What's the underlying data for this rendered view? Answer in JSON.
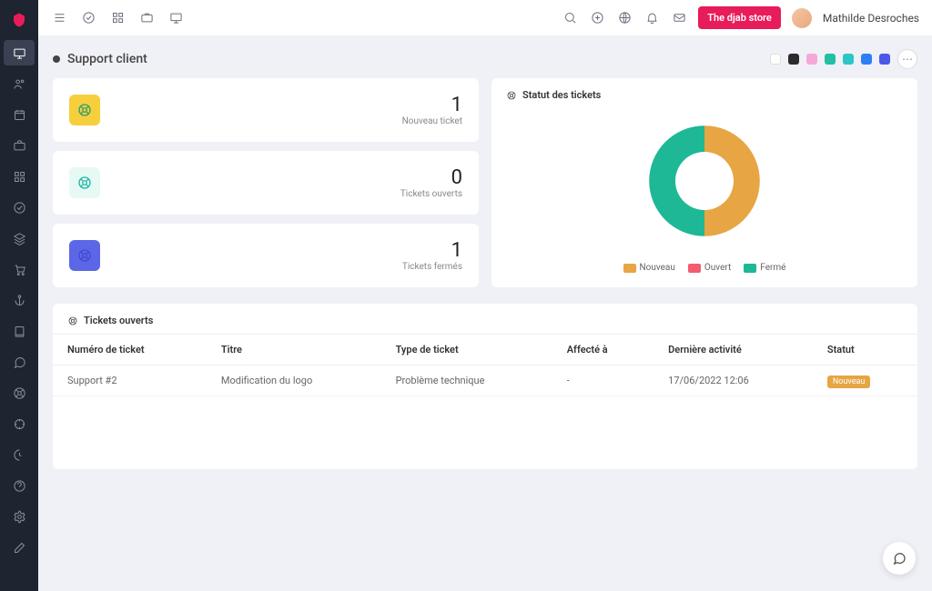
{
  "header": {
    "store_button": "The djab store",
    "username": "Mathilde Desroches"
  },
  "page": {
    "title": "Support client"
  },
  "palette": {
    "colors": [
      "#ffffff",
      "#2b2b2b",
      "#f4a8d8",
      "#22bfa3",
      "#2cc6c6",
      "#2f7ef7",
      "#4a59e8"
    ]
  },
  "stats": {
    "new": {
      "value": "1",
      "label": "Nouveau ticket",
      "bg": "#f7cf3d",
      "ring": "#2f9e6e"
    },
    "open": {
      "value": "0",
      "label": "Tickets ouverts",
      "bg": "#e6f9f4",
      "ring": "#1fb8a3"
    },
    "closed": {
      "value": "1",
      "label": "Tickets fermés",
      "bg": "#5b67e7",
      "ring": "#3f4bd1"
    }
  },
  "chart_title": "Statut des tickets",
  "chart_data": {
    "type": "pie",
    "title": "Statut des tickets",
    "series": [
      {
        "name": "Nouveau",
        "value": 1,
        "color": "#e7a544"
      },
      {
        "name": "Ouvert",
        "value": 0,
        "color": "#f25c6e"
      },
      {
        "name": "Fermé",
        "value": 1,
        "color": "#1fb896"
      }
    ]
  },
  "legend": {
    "new": "Nouveau",
    "open": "Ouvert",
    "closed": "Fermé"
  },
  "open_tickets": {
    "title": "Tickets ouverts",
    "columns": {
      "number": "Numéro de ticket",
      "title": "Titre",
      "type": "Type de ticket",
      "assigned": "Affecté à",
      "activity": "Dernière activité",
      "status": "Statut"
    },
    "rows": [
      {
        "number": "Support #2",
        "title": "Modification du logo",
        "type": "Problème technique",
        "assigned": "-",
        "activity": "17/06/2022 12:06",
        "status": "Nouveau"
      }
    ]
  }
}
